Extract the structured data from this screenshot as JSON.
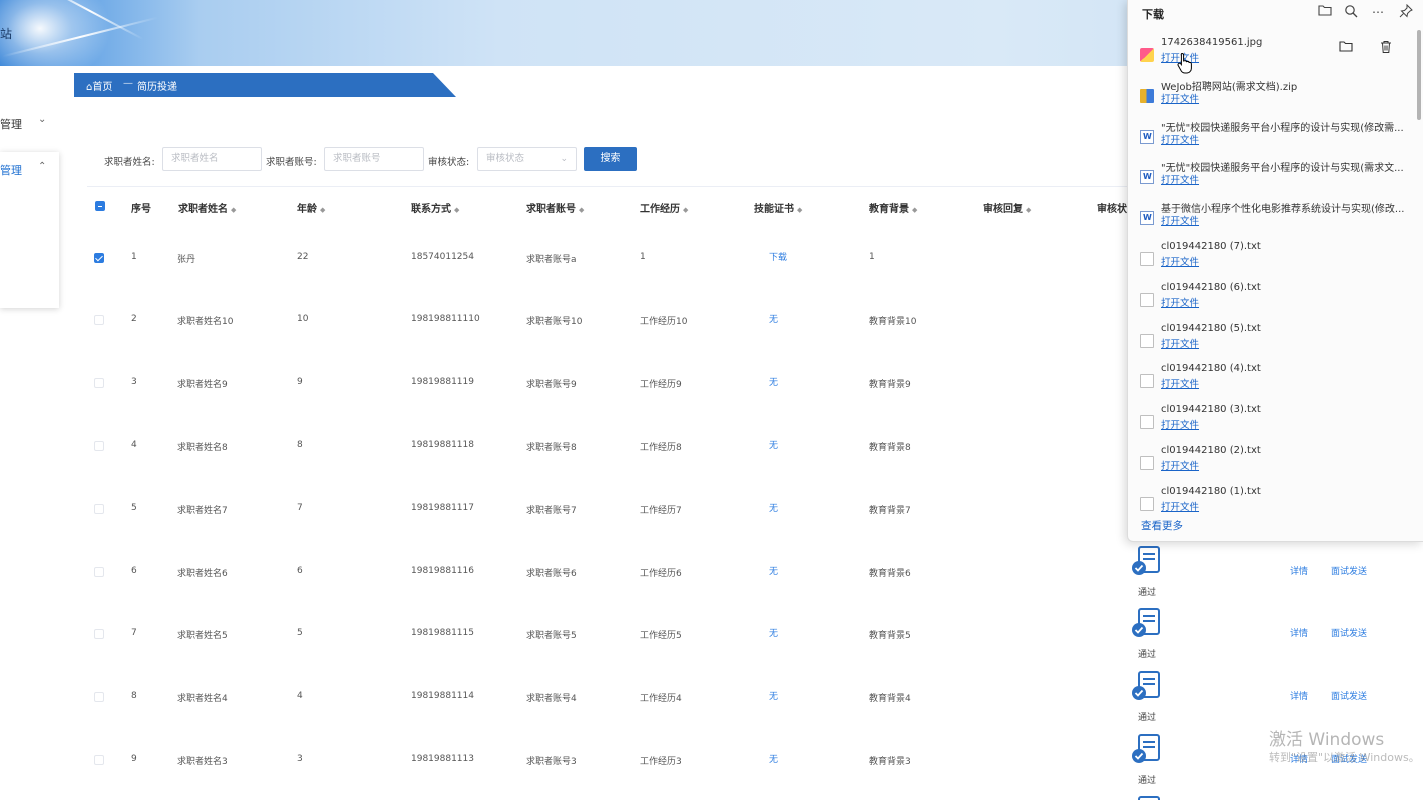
{
  "header": {
    "site_title_fragment": "站"
  },
  "sidebar": {
    "menu1_label": "管理",
    "menu2_label": "管理"
  },
  "breadcrumb": {
    "home": "⌂首页",
    "separator": "—",
    "current": "简历投递"
  },
  "search": {
    "name_label": "求职者姓名:",
    "name_placeholder": "求职者姓名",
    "account_label": "求职者账号:",
    "account_placeholder": "求职者账号",
    "status_label": "审核状态:",
    "status_placeholder": "审核状态",
    "button": "搜索"
  },
  "table": {
    "headers": [
      "序号",
      "求职者姓名",
      "年龄",
      "联系方式",
      "求职者账号",
      "工作经历",
      "技能证书",
      "教育背景",
      "审核回复",
      "审核状"
    ],
    "rows": [
      {
        "no": "1",
        "name": "张丹",
        "age": "22",
        "phone": "18574011254",
        "account": "求职者账号a",
        "work": "1",
        "cert": "下载",
        "edu": "1",
        "checked": true
      },
      {
        "no": "2",
        "name": "求职者姓名10",
        "age": "10",
        "phone": "198198811110",
        "account": "求职者账号10",
        "work": "工作经历10",
        "cert": "无",
        "edu": "教育背景10",
        "checked": false
      },
      {
        "no": "3",
        "name": "求职者姓名9",
        "age": "9",
        "phone": "19819881119",
        "account": "求职者账号9",
        "work": "工作经历9",
        "cert": "无",
        "edu": "教育背景9",
        "checked": false
      },
      {
        "no": "4",
        "name": "求职者姓名8",
        "age": "8",
        "phone": "19819881118",
        "account": "求职者账号8",
        "work": "工作经历8",
        "cert": "无",
        "edu": "教育背景8",
        "checked": false
      },
      {
        "no": "5",
        "name": "求职者姓名7",
        "age": "7",
        "phone": "19819881117",
        "account": "求职者账号7",
        "work": "工作经历7",
        "cert": "无",
        "edu": "教育背景7",
        "checked": false
      },
      {
        "no": "6",
        "name": "求职者姓名6",
        "age": "6",
        "phone": "19819881116",
        "account": "求职者账号6",
        "work": "工作经历6",
        "cert": "无",
        "edu": "教育背景6",
        "checked": false
      },
      {
        "no": "7",
        "name": "求职者姓名5",
        "age": "5",
        "phone": "19819881115",
        "account": "求职者账号5",
        "work": "工作经历5",
        "cert": "无",
        "edu": "教育背景5",
        "checked": false
      },
      {
        "no": "8",
        "name": "求职者姓名4",
        "age": "4",
        "phone": "19819881114",
        "account": "求职者账号4",
        "work": "工作经历4",
        "cert": "无",
        "edu": "教育背景4",
        "checked": false
      },
      {
        "no": "9",
        "name": "求职者姓名3",
        "age": "3",
        "phone": "19819881113",
        "account": "求职者账号3",
        "work": "工作经历3",
        "cert": "无",
        "edu": "教育背景3",
        "checked": false
      }
    ],
    "status_text": "通过",
    "detail_label": "详情",
    "interview_label": "面试发送"
  },
  "downloads": {
    "title": "下载",
    "open_label": "打开文件",
    "more_label": "查看更多",
    "items": [
      {
        "name": "1742638419561.jpg",
        "type": "img"
      },
      {
        "name": "WeJob招聘网站(需求文档).zip",
        "type": "zip"
      },
      {
        "name": "\"无忧\"校园快递服务平台小程序的设计与实现(修改需...",
        "type": "word"
      },
      {
        "name": "\"无忧\"校园快递服务平台小程序的设计与实现(需求文...",
        "type": "word"
      },
      {
        "name": "基于微信小程序个性化电影推荐系统设计与实现(修改...",
        "type": "word"
      },
      {
        "name": "cl019442180 (7).txt",
        "type": "txt"
      },
      {
        "name": "cl019442180 (6).txt",
        "type": "txt"
      },
      {
        "name": "cl019442180 (5).txt",
        "type": "txt"
      },
      {
        "name": "cl019442180 (4).txt",
        "type": "txt"
      },
      {
        "name": "cl019442180 (3).txt",
        "type": "txt"
      },
      {
        "name": "cl019442180 (2).txt",
        "type": "txt"
      },
      {
        "name": "cl019442180 (1).txt",
        "type": "txt"
      }
    ]
  },
  "watermark": {
    "line1": "激活 Windows",
    "line2": "转到\"设置\"以激活 Windows。"
  },
  "colors": {
    "primary": "#2c6fc1",
    "link": "#2c7ce0"
  }
}
